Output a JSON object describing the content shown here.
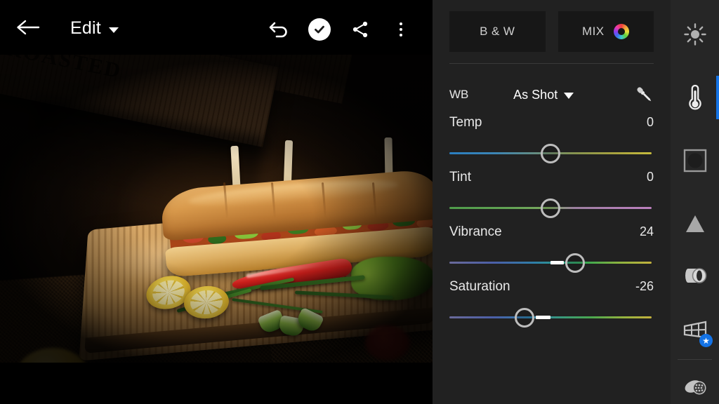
{
  "appbar": {
    "back_icon": "back-arrow-icon",
    "title": "Edit",
    "title_caret": "chevron-down-icon",
    "undo_icon": "undo-icon",
    "confirm_icon": "check-circle-icon",
    "share_icon": "share-icon",
    "more_icon": "more-vertical-icon"
  },
  "photo": {
    "subject": "submarine sandwich on wooden cutting board",
    "crate_text": "BROASTED",
    "crate_text_secondary": "BROASTED"
  },
  "panel": {
    "modes": [
      {
        "label": "B & W",
        "icon": null,
        "selected": false
      },
      {
        "label": "MIX",
        "icon": "color-wheel-icon",
        "selected": false
      }
    ],
    "wb": {
      "label": "WB",
      "value": "As Shot",
      "caret": "chevron-down-icon",
      "eyedropper_icon": "eyedropper-icon"
    },
    "sliders": [
      {
        "name": "Temp",
        "value": "0",
        "position_pct": 50,
        "center_pct": 50,
        "gradient": "linear-gradient(90deg,#2a7ec0 0%,#3b85b6 22%,#6f8f74 48%,#86934f 62%,#a9a33f 82%,#c6bb3d 100%)"
      },
      {
        "name": "Tint",
        "value": "0",
        "position_pct": 50,
        "center_pct": 50,
        "gradient": "linear-gradient(90deg,#4f9c4a 0%,#63a455 30%,#7ba85f 49%,#9c7fa0 62%,#b07fb4 82%,#bb7fbd 100%)"
      },
      {
        "name": "Vibrance",
        "value": "24",
        "position_pct": 62,
        "center_pct": 50,
        "gradient": "linear-gradient(90deg,#6a6a9a 0%,#4b5fa8 22%,#2f7fa8 42%,#2f9a8c 54%,#3aa84f 68%,#8db33f 84%,#c4b23d 100%)"
      },
      {
        "name": "Saturation",
        "value": "-26",
        "position_pct": 37,
        "center_pct": 50,
        "gradient": "linear-gradient(90deg,#6a6a9a 0%,#4b5fa8 22%,#2f7fa8 40%,#3a9a7a 56%,#4aa84f 70%,#95b33f 86%,#c4b23d 100%)"
      }
    ]
  },
  "toolbar": {
    "accent_color": "#1473e6",
    "items": [
      {
        "name": "light-tool",
        "icon": "sun-icon",
        "active": false
      },
      {
        "name": "color-tool",
        "icon": "thermometer-icon",
        "active": true
      },
      {
        "name": "effects-tool",
        "icon": "crop-frame-icon",
        "active": false
      },
      {
        "name": "detail-tool",
        "icon": "triangle-icon",
        "active": false
      },
      {
        "name": "optics-tool",
        "icon": "lens-icon",
        "active": false
      },
      {
        "name": "geometry-tool",
        "icon": "geometry-icon",
        "active": false,
        "badge": "★"
      },
      {
        "name": "healing-tool",
        "icon": "healing-brush-icon",
        "active": false
      }
    ]
  }
}
